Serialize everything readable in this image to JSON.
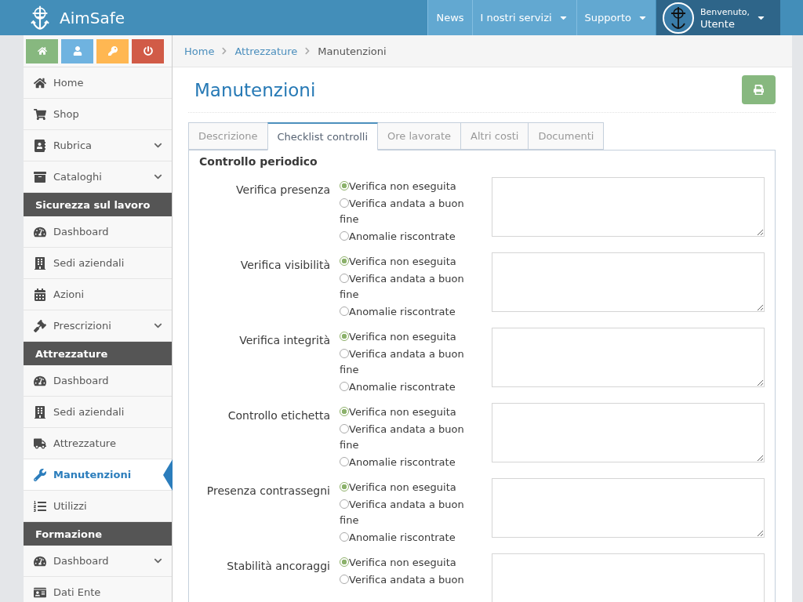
{
  "header": {
    "brand": "AimSafe",
    "nav": [
      {
        "label": "News",
        "dropdown": false
      },
      {
        "label": "I nostri servizi",
        "dropdown": true
      },
      {
        "label": "Supporto",
        "dropdown": true
      }
    ],
    "user": {
      "greeting": "Benvenuto,",
      "name": "Utente"
    }
  },
  "shortcuts": [
    {
      "color": "#87b87f"
    },
    {
      "color": "#6fb3e0"
    },
    {
      "color": "#ffb752"
    },
    {
      "color": "#d15b47"
    }
  ],
  "sidebar": [
    {
      "kind": "link",
      "label": "Home",
      "expandable": false,
      "selected": false
    },
    {
      "kind": "link",
      "label": "Shop",
      "expandable": false,
      "selected": false
    },
    {
      "kind": "link",
      "label": "Rubrica",
      "expandable": true,
      "selected": false
    },
    {
      "kind": "link",
      "label": "Cataloghi",
      "expandable": true,
      "selected": false
    },
    {
      "kind": "header",
      "label": "Sicurezza sul lavoro"
    },
    {
      "kind": "link",
      "label": "Dashboard",
      "expandable": false,
      "selected": false
    },
    {
      "kind": "link",
      "label": "Sedi aziendali",
      "expandable": false,
      "selected": false
    },
    {
      "kind": "link",
      "label": "Azioni",
      "expandable": false,
      "selected": false
    },
    {
      "kind": "link",
      "label": "Prescrizioni",
      "expandable": true,
      "selected": false
    },
    {
      "kind": "header",
      "label": "Attrezzature"
    },
    {
      "kind": "link",
      "label": "Dashboard",
      "expandable": false,
      "selected": false
    },
    {
      "kind": "link",
      "label": "Sedi aziendali",
      "expandable": false,
      "selected": false
    },
    {
      "kind": "link",
      "label": "Attrezzature",
      "expandable": false,
      "selected": false
    },
    {
      "kind": "link",
      "label": "Manutenzioni",
      "expandable": false,
      "selected": true
    },
    {
      "kind": "link",
      "label": "Utilizzi",
      "expandable": false,
      "selected": false
    },
    {
      "kind": "header",
      "label": "Formazione"
    },
    {
      "kind": "link",
      "label": "Dashboard",
      "expandable": true,
      "selected": false
    },
    {
      "kind": "link",
      "label": "Dati Ente",
      "expandable": false,
      "selected": false
    }
  ],
  "breadcrumb": [
    "Home",
    "Attrezzature",
    "Manutenzioni"
  ],
  "page_title": "Manutenzioni",
  "tabs": [
    {
      "label": "Descrizione",
      "selected": false
    },
    {
      "label": "Checklist controlli",
      "selected": true
    },
    {
      "label": "Ore lavorate",
      "selected": false
    },
    {
      "label": "Altri costi",
      "selected": false
    },
    {
      "label": "Documenti",
      "selected": false
    }
  ],
  "section_title": "Controllo periodico",
  "checks": [
    {
      "label": "Verifica presenza",
      "options": [
        {
          "label": "Verifica non eseguita",
          "selected": true
        },
        {
          "label": "Verifica andata a buon fine",
          "selected": false
        },
        {
          "label": "Anomalie riscontrate",
          "selected": false
        }
      ]
    },
    {
      "label": "Verifica visibilità",
      "options": [
        {
          "label": "Verifica non eseguita",
          "selected": true
        },
        {
          "label": "Verifica andata a buon fine",
          "selected": false
        },
        {
          "label": "Anomalie riscontrate",
          "selected": false
        }
      ]
    },
    {
      "label": "Verifica integrità",
      "options": [
        {
          "label": "Verifica non eseguita",
          "selected": true
        },
        {
          "label": "Verifica andata a buon fine",
          "selected": false
        },
        {
          "label": "Anomalie riscontrate",
          "selected": false
        }
      ]
    },
    {
      "label": "Controllo etichetta",
      "options": [
        {
          "label": "Verifica non eseguita",
          "selected": true
        },
        {
          "label": "Verifica andata a buon fine",
          "selected": false
        },
        {
          "label": "Anomalie riscontrate",
          "selected": false
        }
      ]
    },
    {
      "label": "Presenza contrassegni",
      "options": [
        {
          "label": "Verifica non eseguita",
          "selected": true
        },
        {
          "label": "Verifica andata a buon fine",
          "selected": false
        },
        {
          "label": "Anomalie riscontrate",
          "selected": false
        }
      ]
    },
    {
      "label": "Stabilità ancoraggi",
      "options": [
        {
          "label": "Verifica non eseguita",
          "selected": true
        },
        {
          "label": "Verifica andata a buon",
          "selected": false
        }
      ]
    }
  ]
}
